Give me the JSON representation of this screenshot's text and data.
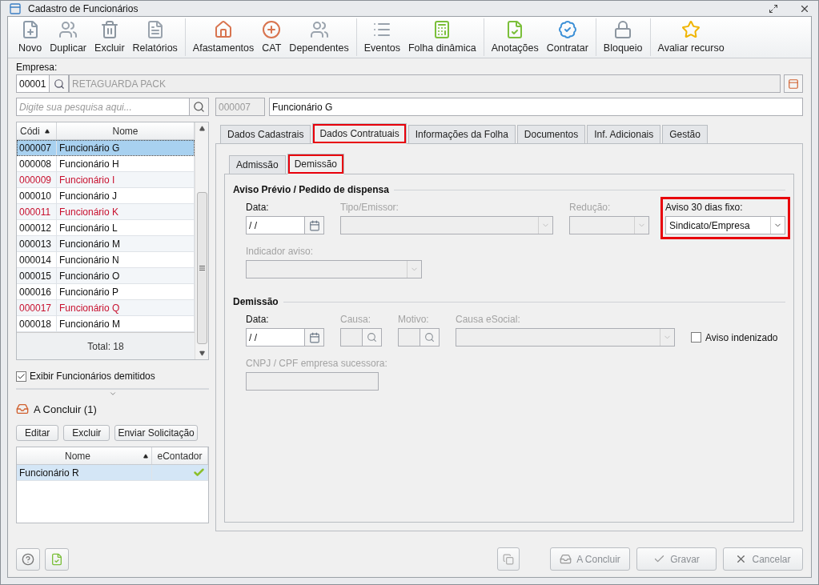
{
  "window": {
    "title": "Cadastro de Funcionários"
  },
  "toolbar": [
    [
      {
        "label": "Novo"
      },
      {
        "label": "Duplicar"
      },
      {
        "label": "Excluir"
      },
      {
        "label": "Relatórios"
      }
    ],
    [
      {
        "label": "Afastamentos"
      },
      {
        "label": "CAT"
      },
      {
        "label": "Dependentes"
      }
    ],
    [
      {
        "label": "Eventos"
      },
      {
        "label": "Folha dinâmica"
      }
    ],
    [
      {
        "label": "Anotações"
      },
      {
        "label": "Contratar"
      }
    ],
    [
      {
        "label": "Bloqueio"
      }
    ],
    [
      {
        "label": "Avaliar recurso"
      }
    ]
  ],
  "empresa": {
    "label": "Empresa:",
    "code": "00001",
    "name": "RETAGUARDA PACK"
  },
  "search": {
    "placeholder": "Digite sua pesquisa aqui..."
  },
  "employee_list": {
    "columns": [
      "Códi",
      "Nome"
    ],
    "total": "Total: 18",
    "rows": [
      {
        "code": "000007",
        "name": "Funcionário G",
        "selected": true,
        "dismissed": false
      },
      {
        "code": "000008",
        "name": "Funcionário H",
        "selected": false,
        "dismissed": false
      },
      {
        "code": "000009",
        "name": "Funcionário I",
        "selected": false,
        "dismissed": true
      },
      {
        "code": "000010",
        "name": "Funcionário J",
        "selected": false,
        "dismissed": false
      },
      {
        "code": "000011",
        "name": "Funcionário K",
        "selected": false,
        "dismissed": true
      },
      {
        "code": "000012",
        "name": "Funcionário L",
        "selected": false,
        "dismissed": false
      },
      {
        "code": "000013",
        "name": "Funcionário M",
        "selected": false,
        "dismissed": false
      },
      {
        "code": "000014",
        "name": "Funcionário N",
        "selected": false,
        "dismissed": false
      },
      {
        "code": "000015",
        "name": "Funcionário O",
        "selected": false,
        "dismissed": false
      },
      {
        "code": "000016",
        "name": "Funcionário P",
        "selected": false,
        "dismissed": false
      },
      {
        "code": "000017",
        "name": "Funcionário Q",
        "selected": false,
        "dismissed": true
      },
      {
        "code": "000018",
        "name": "Funcionário M",
        "selected": false,
        "dismissed": false
      }
    ]
  },
  "show_dismissed": {
    "label": "Exibir Funcionários demitidos",
    "checked": true
  },
  "pending": {
    "title": "A Concluir (1)",
    "buttons": [
      "Editar",
      "Excluir",
      "Enviar Solicitação"
    ],
    "columns": [
      "Nome",
      "eContador"
    ],
    "rows": [
      {
        "name": "Funcionário R",
        "econtador": true,
        "selected": true
      }
    ]
  },
  "current": {
    "code": "000007",
    "name": "Funcionário G"
  },
  "tabs": [
    {
      "label": "Dados Cadastrais",
      "selected": false,
      "highlighted": false
    },
    {
      "label": "Dados Contratuais",
      "selected": true,
      "highlighted": true
    },
    {
      "label": "Informações da Folha",
      "selected": false,
      "highlighted": false
    },
    {
      "label": "Documentos",
      "selected": false,
      "highlighted": false
    },
    {
      "label": "Inf. Adicionais",
      "selected": false,
      "highlighted": false
    },
    {
      "label": "Gestão",
      "selected": false,
      "highlighted": false
    }
  ],
  "subtabs": [
    {
      "label": "Admissão",
      "selected": false,
      "highlighted": false
    },
    {
      "label": "Demissão",
      "selected": true,
      "highlighted": true
    }
  ],
  "sections": [
    {
      "title": "Aviso Prévio / Pedido de dispensa",
      "rows": [
        [
          {
            "kind": "date",
            "label": "Data:",
            "value": "/ /",
            "disabled": false,
            "highlighted": false
          },
          {
            "kind": "combo",
            "label": "Tipo/Emissor:",
            "disabled": true,
            "highlighted": false
          },
          {
            "kind": "combo",
            "label": "Redução:",
            "disabled": true,
            "highlighted": false
          },
          {
            "kind": "combo",
            "label": "Aviso 30 dias fixo:",
            "value": "Sindicato/Empresa",
            "disabled": false,
            "highlighted": true
          }
        ],
        [
          {
            "kind": "combo",
            "label": "Indicador aviso:",
            "disabled": true,
            "highlighted": false
          }
        ]
      ]
    },
    {
      "title": "Demissão",
      "rows": [
        [
          {
            "kind": "date",
            "label": "Data:",
            "value": "/ /",
            "disabled": false,
            "highlighted": false
          },
          {
            "kind": "lookup",
            "label": "Causa:",
            "disabled": true,
            "highlighted": false
          },
          {
            "kind": "lookup",
            "label": "Motivo:",
            "disabled": true,
            "highlighted": false
          },
          {
            "kind": "combo",
            "label": "Causa eSocial:",
            "disabled": true,
            "highlighted": false
          },
          {
            "kind": "checkbox",
            "label": "Aviso indenizado",
            "checked": false,
            "disabled": false,
            "highlighted": false
          }
        ],
        [
          {
            "kind": "text",
            "label": "CNPJ / CPF empresa sucessora:",
            "disabled": true,
            "highlighted": false
          }
        ]
      ]
    }
  ],
  "footer_buttons": [
    {
      "label": "A Concluir",
      "disabled": true
    },
    {
      "label": "Gravar",
      "disabled": true
    },
    {
      "label": "Cancelar",
      "disabled": true
    }
  ]
}
